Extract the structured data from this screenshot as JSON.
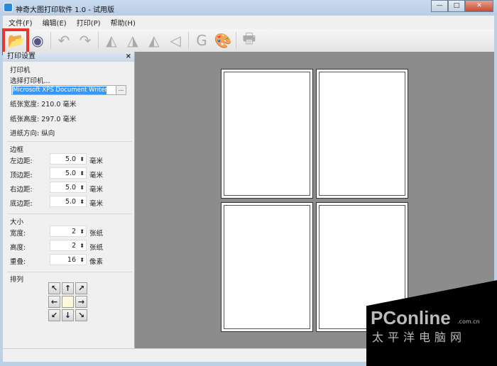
{
  "window": {
    "title": "神奇大图打印软件 1.0 - 试用版",
    "controls": [
      "—",
      "□",
      "✕"
    ]
  },
  "menu": [
    "文件(F)",
    "编辑(E)",
    "打印(P)",
    "帮助(H)"
  ],
  "toolbar": [
    {
      "name": "open-file-icon",
      "glyph": "📂"
    },
    {
      "name": "webcam-icon",
      "glyph": "◉"
    },
    {
      "name": "undo-icon",
      "glyph": "↶"
    },
    {
      "name": "redo-icon",
      "glyph": "↷"
    },
    {
      "name": "rotate-left-icon",
      "glyph": "◭"
    },
    {
      "name": "rotate-right-icon",
      "glyph": "◮"
    },
    {
      "name": "flip-horizontal-icon",
      "glyph": "◭"
    },
    {
      "name": "flip-vertical-icon",
      "glyph": "◁"
    },
    {
      "name": "grayscale-icon",
      "glyph": "G"
    },
    {
      "name": "palette-icon",
      "glyph": "🎨"
    },
    {
      "name": "printer-icon",
      "glyph": "🖶"
    }
  ],
  "panel": {
    "title": "打印设置",
    "close": "×",
    "printer": {
      "group": "打印机",
      "select_label": "选择打印机...",
      "value": "Microsoft XPS Document Writer",
      "browse": "...",
      "width": "纸张宽度: 210.0 毫米",
      "height": "纸张高度: 297.0 毫米",
      "direction": "进纸方向: 纵向"
    },
    "margins": {
      "group": "边框",
      "rows": [
        {
          "label": "左边距:",
          "value": "5.0",
          "unit": "毫米"
        },
        {
          "label": "顶边距:",
          "value": "5.0",
          "unit": "毫米"
        },
        {
          "label": "右边距:",
          "value": "5.0",
          "unit": "毫米"
        },
        {
          "label": "底边距:",
          "value": "5.0",
          "unit": "毫米"
        }
      ]
    },
    "size": {
      "group": "大小",
      "rows": [
        {
          "label": "宽度:",
          "value": "2",
          "unit": "张纸"
        },
        {
          "label": "高度:",
          "value": "2",
          "unit": "张纸"
        },
        {
          "label": "重叠:",
          "value": "16",
          "unit": "像素"
        }
      ]
    },
    "arrange": {
      "group": "排列",
      "arrows": [
        "↖",
        "↑",
        "↗",
        "←",
        "",
        "→",
        "↙",
        "↓",
        "↘"
      ]
    }
  },
  "preview": {
    "columns": 2,
    "rows": 2
  },
  "watermark": {
    "brand": "PConline",
    "domain": ".com.cn",
    "cn": "太平洋电脑网"
  }
}
